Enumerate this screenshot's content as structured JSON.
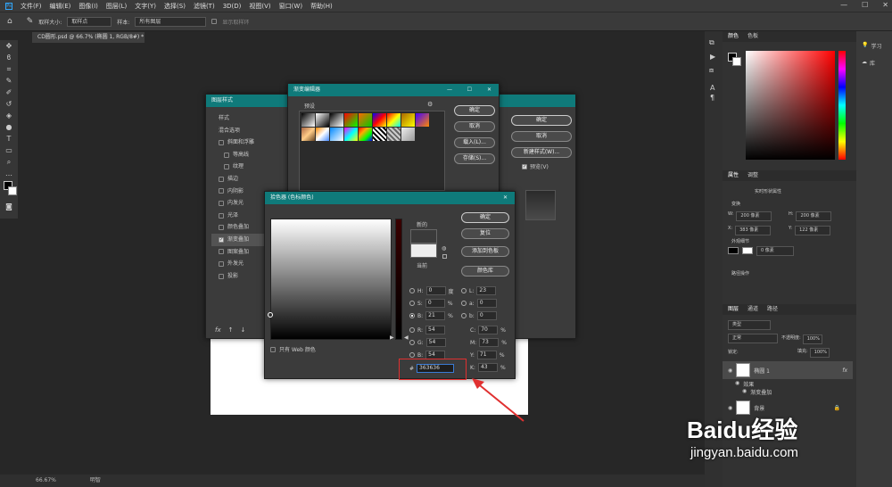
{
  "menubar": {
    "items": [
      "文件(F)",
      "编辑(E)",
      "图像(I)",
      "图层(L)",
      "文字(Y)",
      "选择(S)",
      "滤镜(T)",
      "3D(D)",
      "视图(V)",
      "窗口(W)",
      "帮助(H)"
    ]
  },
  "options": {
    "sample_size_label": "取样大小:",
    "sample_size_value": "取样点",
    "sample_label": "样本:",
    "sample_value": "所有图层",
    "ring_label": "显示取样环"
  },
  "document": {
    "tab_title": "CD圆形.psd @ 66.7% (椭圆 1, RGB/8#) *"
  },
  "status": {
    "zoom": "66.67%",
    "doc": "明智"
  },
  "layer_style": {
    "title": "图层样式",
    "section_style": "样式",
    "section_blend": "混合选项",
    "items": [
      {
        "label": "斜面和浮雕",
        "checked": false
      },
      {
        "label": "等高线",
        "checked": false
      },
      {
        "label": "纹理",
        "checked": false
      },
      {
        "label": "描边",
        "checked": false
      },
      {
        "label": "内阴影",
        "checked": false
      },
      {
        "label": "内发光",
        "checked": false
      },
      {
        "label": "光泽",
        "checked": false
      },
      {
        "label": "颜色叠加",
        "checked": false
      },
      {
        "label": "渐变叠加",
        "checked": true
      },
      {
        "label": "图案叠加",
        "checked": false
      },
      {
        "label": "外发光",
        "checked": false
      },
      {
        "label": "投影",
        "checked": false
      }
    ],
    "fx": "fx",
    "ok": "确定",
    "reset": "取消",
    "new_style": "新建样式(W)...",
    "preview": "预览(V)"
  },
  "gradient_editor": {
    "title": "渐变编辑器",
    "presets": "预设",
    "ok": "确定",
    "cancel": "取消",
    "load": "载入(L)...",
    "save": "存储(S)..."
  },
  "color_picker": {
    "title": "拾色器 (色标颜色)",
    "new_label": "新的",
    "current_label": "当前",
    "ok": "确定",
    "reset": "复位",
    "add_swatch": "添加到色板",
    "libraries": "颜色库",
    "web_only": "只有 Web 颜色",
    "H": "0",
    "H_unit": "度",
    "S": "0",
    "S_unit": "%",
    "B": "21",
    "B_unit": "%",
    "R": "54",
    "G": "54",
    "Bc": "54",
    "L": "23",
    "a": "0",
    "b": "0",
    "C": "70",
    "M": "73",
    "Y": "71",
    "K": "43",
    "pct": "%",
    "hex_label": "#",
    "hex": "363636",
    "labels": {
      "H": "H:",
      "S": "S:",
      "B": "B:",
      "R": "R:",
      "G": "G:",
      "Bc": "B:",
      "L": "L:",
      "a": "a:",
      "b": "b:",
      "C": "C:",
      "M": "M:",
      "Y": "Y:",
      "K": "K:"
    }
  },
  "right_panel": {
    "color_tab": "颜色",
    "swatch_tab": "色板",
    "props_tab": "属性",
    "adjust_tab": "调整",
    "shape_props": "实时形状属性",
    "transform": "变换",
    "w_label": "W:",
    "w_value": "200 像素",
    "h_label": "H:",
    "h_value": "200 像素",
    "x_label": "X:",
    "x_value": "383 像素",
    "y_label": "Y:",
    "y_value": "122 像素",
    "appearance": "外观细节",
    "stroke_value": "0 像素",
    "path_ops": "路径操作",
    "layers_tab": "图层",
    "channels_tab": "通道",
    "paths_tab": "路径",
    "kind": "类型",
    "blend_mode": "正常",
    "opacity_label": "不透明度:",
    "opacity": "100%",
    "lock_label": "锁定:",
    "fill_label": "填充:",
    "fill": "100%",
    "layer_name": "椭圆 1",
    "effects_label": "效果",
    "grad_overlay": "渐变叠加",
    "bg_layer": "背景"
  },
  "far_right": {
    "learn": "学习",
    "library": "库"
  },
  "watermark": {
    "brand": "Baidu经验",
    "url": "jingyan.baidu.com"
  },
  "colors": {
    "accent": "#0f7a7a",
    "highlight": "#e03030",
    "picked": "#363636"
  }
}
